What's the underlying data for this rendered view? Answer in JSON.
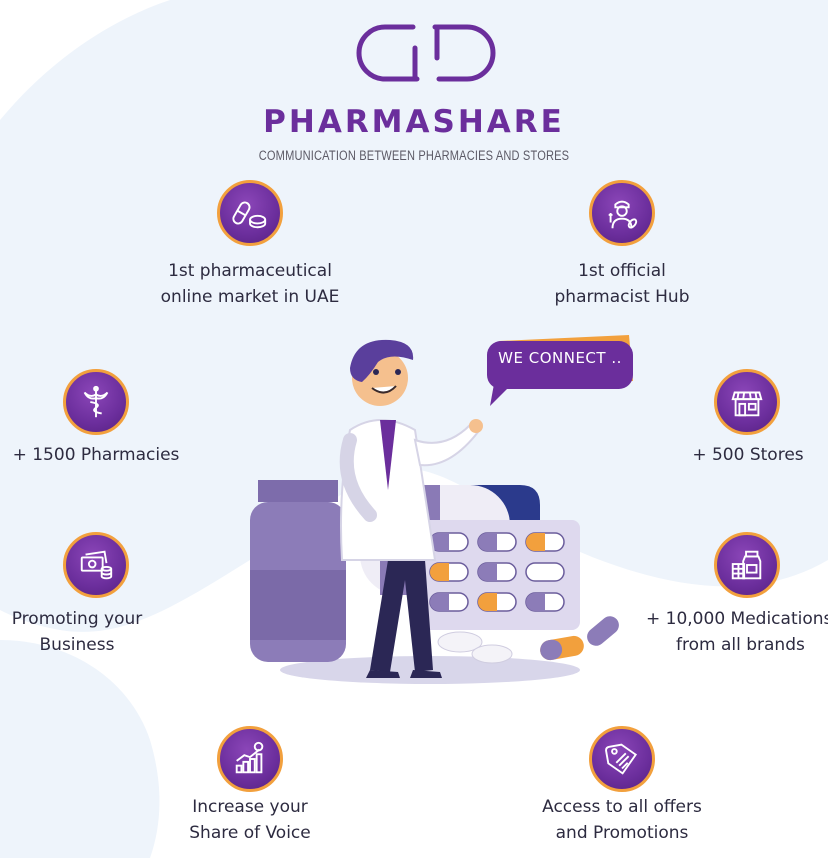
{
  "brand": {
    "name": "PHARMASHARE",
    "tagline": "COMMUNICATION BETWEEN PHARMACIES AND STORES"
  },
  "bubble": {
    "text": "WE CONNECT .."
  },
  "features": {
    "online_market": {
      "line1": "1st pharmaceutical",
      "line2": "online market in UAE",
      "icon": "pills-icon"
    },
    "pharmacist_hub": {
      "line1": "1st official",
      "line2": "pharmacist Hub",
      "icon": "pharmacist-icon"
    },
    "pharmacies": {
      "line1": "+ 1500 Pharmacies",
      "icon": "caduceus-icon"
    },
    "stores": {
      "line1": "+ 500 Stores",
      "icon": "storefront-icon"
    },
    "promoting": {
      "line1": "Promoting your",
      "line2": "Business",
      "icon": "money-icon"
    },
    "medications": {
      "line1": "+ 10,000 Medications",
      "line2": "from all brands",
      "icon": "medicine-bottle-icon"
    },
    "share_voice": {
      "line1": "Increase your",
      "line2": "Share of Voice",
      "icon": "growth-chart-icon"
    },
    "offers": {
      "line1": "Access to all offers",
      "line2": "and Promotions",
      "icon": "price-tag-icon"
    }
  },
  "colors": {
    "brand_purple": "#6b2e9c",
    "accent_orange": "#f2a03d",
    "background_blob": "#eef4fb",
    "text_dark": "#2d2b40"
  }
}
